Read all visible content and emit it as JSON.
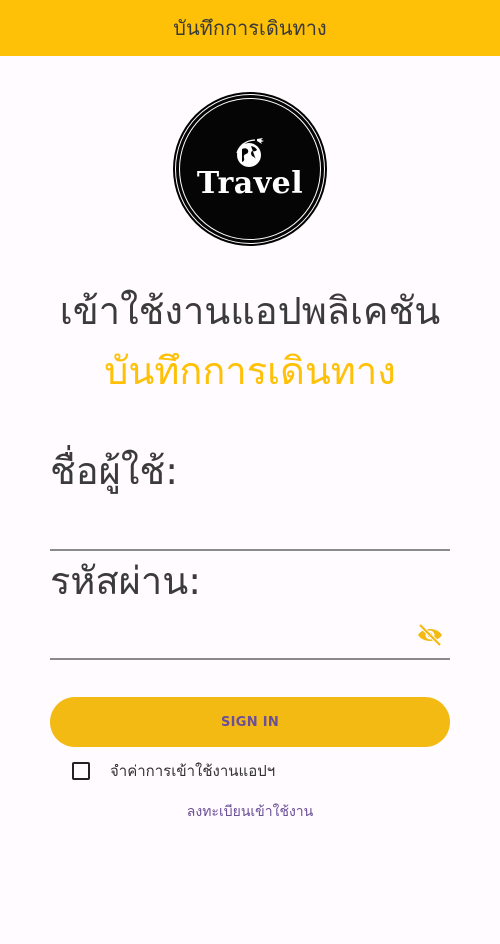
{
  "app_bar": {
    "title": "บันทึกการเดินทาง"
  },
  "logo": {
    "text": "Travel",
    "icon": "globe-plane-icon"
  },
  "heading": {
    "line1": "เข้าใช้งานแอปพลิเคชัน",
    "line2": "บันทึกการเดินทาง"
  },
  "form": {
    "username_label": "ชื่อผู้ใช้:",
    "username_value": "",
    "password_label": "รหัสผ่าน:",
    "password_value": "",
    "password_toggle_icon": "eye-off-icon",
    "signin_label": "SIGN IN",
    "remember_label": "จำค่าการเข้าใช้งานแอปฯ",
    "remember_checked": false,
    "register_link": "ลงทะเบียนเข้าใช้งาน"
  },
  "colors": {
    "accent": "#ffc107",
    "button": "#f4ba14",
    "button_text": "#6b4f98",
    "link": "#6b4f98",
    "text": "#3b3b3b",
    "background": "#fffbfe"
  }
}
